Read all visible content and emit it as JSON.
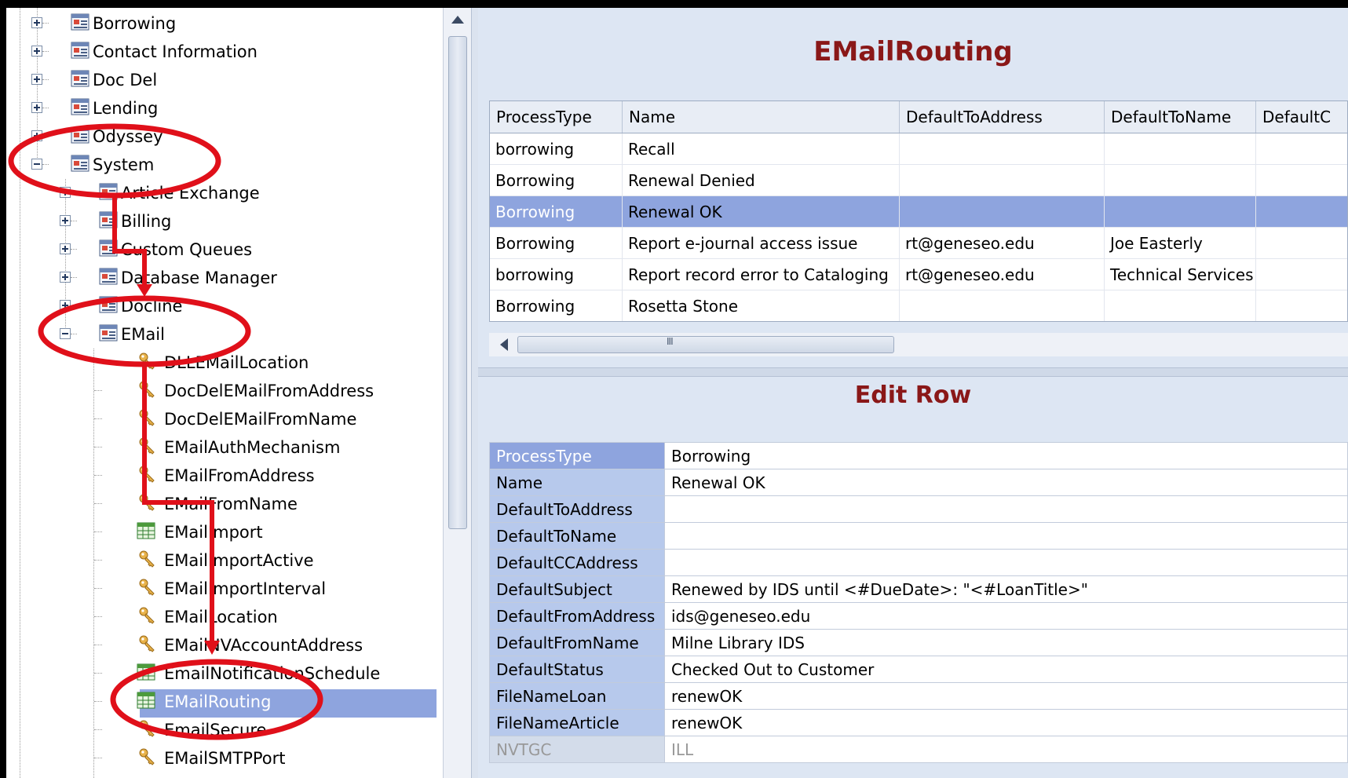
{
  "tree": {
    "top_nodes": [
      {
        "label": "Borrowing",
        "expander": "plus"
      },
      {
        "label": "Contact Information",
        "expander": "plus"
      },
      {
        "label": "Doc Del",
        "expander": "plus"
      },
      {
        "label": "Lending",
        "expander": "plus"
      },
      {
        "label": "Odyssey",
        "expander": "plus"
      },
      {
        "label": "System",
        "expander": "minus"
      }
    ],
    "system_children": [
      {
        "label": "Article Exchange",
        "expander": "plus"
      },
      {
        "label": "Billing",
        "expander": "plus"
      },
      {
        "label": "Custom Queues",
        "expander": "plus"
      },
      {
        "label": "Database Manager",
        "expander": "plus"
      },
      {
        "label": "Docline",
        "expander": "plus"
      },
      {
        "label": "EMail",
        "expander": "minus"
      }
    ],
    "email_children": [
      {
        "label": "DLLEMailLocation",
        "icon": "key-icon"
      },
      {
        "label": "DocDelEMailFromAddress",
        "icon": "key-icon"
      },
      {
        "label": "DocDelEMailFromName",
        "icon": "key-icon"
      },
      {
        "label": "EMailAuthMechanism",
        "icon": "key-icon"
      },
      {
        "label": "EMailFromAddress",
        "icon": "key-icon"
      },
      {
        "label": "EMailFromName",
        "icon": "key-icon"
      },
      {
        "label": "EMailImport",
        "icon": "table-icon"
      },
      {
        "label": "EMailImportActive",
        "icon": "key-icon"
      },
      {
        "label": "EMailImportInterval",
        "icon": "key-icon"
      },
      {
        "label": "EMailLocation",
        "icon": "key-icon"
      },
      {
        "label": "EMailNVAccountAddress",
        "icon": "key-icon"
      },
      {
        "label": "EmailNotificationSchedule",
        "icon": "table-icon"
      },
      {
        "label": "EMailRouting",
        "icon": "table-icon",
        "selected": true
      },
      {
        "label": "EmailSecure",
        "icon": "key-icon"
      },
      {
        "label": "EMailSMTPPort",
        "icon": "key-icon"
      }
    ]
  },
  "top_pane": {
    "title": "EMailRouting",
    "columns": [
      "ProcessType",
      "Name",
      "DefaultToAddress",
      "DefaultToName",
      "DefaultC"
    ],
    "rows": [
      [
        "borrowing",
        "Recall",
        "",
        "",
        ""
      ],
      [
        "Borrowing",
        "Renewal Denied",
        "",
        "",
        ""
      ],
      [
        "Borrowing",
        "Renewal OK",
        "",
        "",
        ""
      ],
      [
        "Borrowing",
        "Report e-journal access issue",
        "rt@geneseo.edu",
        "Joe Easterly",
        ""
      ],
      [
        "borrowing",
        "Report record error to Cataloging",
        "rt@geneseo.edu",
        "Technical Services",
        ""
      ],
      [
        "Borrowing",
        "Rosetta Stone",
        "",
        "",
        ""
      ]
    ],
    "selected_row": 2
  },
  "edit_pane": {
    "title": "Edit Row",
    "fields": [
      {
        "key": "ProcessType",
        "value": "Borrowing"
      },
      {
        "key": "Name",
        "value": "Renewal OK"
      },
      {
        "key": "DefaultToAddress",
        "value": ""
      },
      {
        "key": "DefaultToName",
        "value": ""
      },
      {
        "key": "DefaultCCAddress",
        "value": ""
      },
      {
        "key": "DefaultSubject",
        "value": "Renewed by IDS until <#DueDate>: \"<#LoanTitle>\""
      },
      {
        "key": "DefaultFromAddress",
        "value": "ids@geneseo.edu"
      },
      {
        "key": "DefaultFromName",
        "value": "Milne Library IDS"
      },
      {
        "key": "DefaultStatus",
        "value": "Checked Out to Customer"
      },
      {
        "key": "FileNameLoan",
        "value": "renewOK"
      },
      {
        "key": "FileNameArticle",
        "value": "renewOK"
      },
      {
        "key": "NVTGC",
        "value": "ILL"
      }
    ],
    "selected_field": 0,
    "disabled_fields": [
      11
    ]
  },
  "colors": {
    "title": "#8a1818",
    "selection": "#8ea4de",
    "annotation": "#e0101a"
  },
  "scrollbar": {
    "h_grip": "III"
  }
}
